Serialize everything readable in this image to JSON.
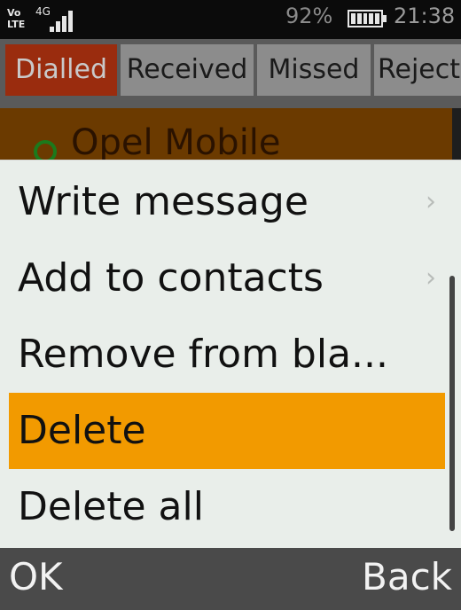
{
  "status": {
    "volte_top": "Vo",
    "volte_bottom": "LTE",
    "network": "4G",
    "battery_percent": "92%",
    "battery_level": 0.92,
    "time": "21:38"
  },
  "tabs": [
    {
      "label": "Dialled",
      "active": true
    },
    {
      "label": "Received",
      "active": false
    },
    {
      "label": "Missed",
      "active": false
    },
    {
      "label": "Reject",
      "active": false
    }
  ],
  "background_entry": {
    "name": "Opel Mobile"
  },
  "menu": {
    "items": [
      {
        "label": "Write message",
        "has_submenu": true
      },
      {
        "label": "Add to contacts",
        "has_submenu": true
      },
      {
        "label": "Remove from bla...",
        "has_submenu": false
      },
      {
        "label": "Delete",
        "has_submenu": false,
        "selected": true
      },
      {
        "label": "Delete all",
        "has_submenu": false
      }
    ],
    "chevron": "›"
  },
  "softkeys": {
    "left": "OK",
    "right": "Back"
  },
  "colors": {
    "selected": "#f29a00",
    "active_tab": "#9a2c0e",
    "menu_bg": "#e9eeea"
  }
}
